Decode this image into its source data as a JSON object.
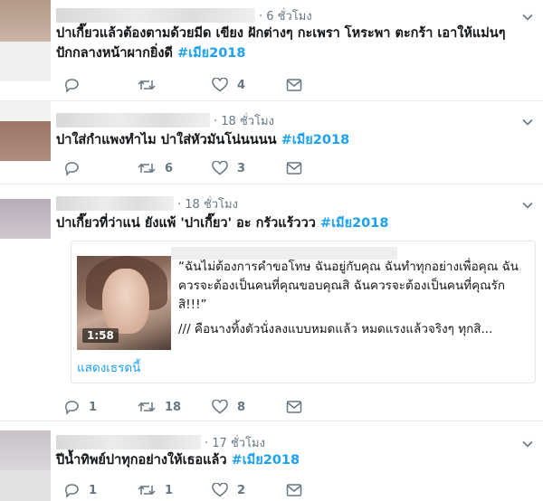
{
  "tweets": [
    {
      "time": "· 6 ชั่วโมง",
      "text": "ปาเกี๊ยวแล้วต้องตามด้วยมีด เขียง ฝักต่างๆ กะเพรา โหระพา ตะกร้า เอาให้แม่นๆ ปักกลางหน้าผากยิ่งดี",
      "hashtag": "#เมีย2018",
      "reply_count": "",
      "retweet_count": "",
      "like_count": "4",
      "avatar_color": "#b49a88"
    },
    {
      "time": "· 18 ชั่วโมง",
      "text": "ปาใส่กำแพงทำไม ปาใส่หัวมันโน่นนนน",
      "hashtag": "#เมีย2018",
      "reply_count": "",
      "retweet_count": "6",
      "like_count": "3",
      "avatar_color": "#9c7468"
    },
    {
      "time": "· 18 ชั่วโมง",
      "text": "ปาเกี๊ยวที่ว่าแน่ ยังแพ้ 'ปาเกี๊ยว' อะ กรัวแร้ววว",
      "hashtag": "#เมีย2018",
      "reply_count": "1",
      "retweet_count": "18",
      "like_count": "8",
      "avatar_color": "#b8acb8",
      "card": {
        "video_duration": "1:58",
        "quote_line1": "“ฉันไม่ต้องการคำขอโทษ ฉันอยู่กับคุณ ฉันทำทุกอย่างเพื่อคุณ ฉันควรจะต้องเป็นคนที่คุณขอบคุณสิ ฉันควรจะต้องเป็นคนที่คุณรักสิ!!!”",
        "quote_line2": "/// คือนางทิ้งตัวนั่งลงแบบหมดแล้ว หมดแรงแล้วจริงๆ ทุกสิ...",
        "show_thread": "แสดงเธรดนี้"
      }
    },
    {
      "time": "· 17 ชั่วโมง",
      "text": "ปีน้ำทิพย์ปาทุกอย่างให้เธอแล้ว",
      "hashtag": "#เมีย2018",
      "reply_count": "1",
      "retweet_count": "1",
      "like_count": "2",
      "avatar_color": "#c8c2c8"
    }
  ],
  "colors": {
    "accent": "#1da1f2",
    "muted": "#657786",
    "border": "#e6ecf0"
  },
  "icons": [
    "reply-icon",
    "retweet-icon",
    "like-icon",
    "direct-message-icon",
    "chevron-down-icon"
  ]
}
